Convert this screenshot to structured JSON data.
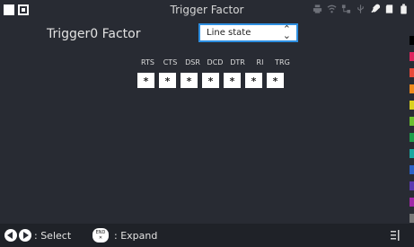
{
  "window": {
    "title": "Trigger Factor"
  },
  "page": {
    "heading": "Trigger0 Factor"
  },
  "select": {
    "value": "Line state",
    "chevron": "⌃⌄"
  },
  "columns": [
    "RTS",
    "CTS",
    "DSR",
    "DCD",
    "DTR",
    "RI",
    "TRG"
  ],
  "cells": [
    "*",
    "*",
    "*",
    "*",
    "*",
    "*",
    "*"
  ],
  "bottom": {
    "select_hint": ": Select",
    "end_key_top": "END",
    "end_key_bottom": "✕",
    "expand_hint": ": Expand"
  },
  "status_icons": [
    "printer-icon",
    "wifi-icon",
    "network-icon",
    "usb-icon",
    "link-icon",
    "sd-card-icon",
    "battery-icon"
  ],
  "swatch_colors": [
    "#000000",
    "#e0245e",
    "#e84a3a",
    "#f08a1c",
    "#d9d01e",
    "#6cbf2f",
    "#1e9e4a",
    "#1aa7a0",
    "#2b61c7",
    "#5a3ab0",
    "#a028a6",
    "#7a7a7a",
    "#ffffff"
  ],
  "colors": {
    "accent": "#2e8fe0",
    "background": "#282b33"
  }
}
